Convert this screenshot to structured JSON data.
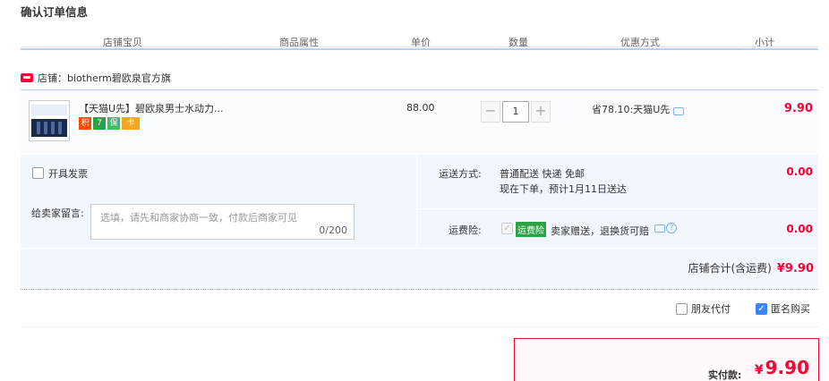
{
  "section_title": "确认订单信息",
  "columns": [
    "店铺宝贝",
    "商品属性",
    "单价",
    "数量",
    "优惠方式",
    "小计"
  ],
  "shop": {
    "label": "店铺：biotherm碧欧泉官方旗"
  },
  "item": {
    "title": "【天猫U先】碧欧泉男士水动力...",
    "badges": [
      "积",
      "7",
      "保",
      "卡"
    ],
    "unit_price": "88.00",
    "quantity": "1",
    "decrement": "−",
    "increment": "+",
    "discount": "省78.10:天猫U先",
    "subtotal": "9.90"
  },
  "invoice": {
    "label": "开具发票"
  },
  "message": {
    "label": "给卖家留言:",
    "placeholder": "选填，请先和商家协商一致，付款后商家可见",
    "count": "0/200"
  },
  "shipping": {
    "label": "运送方式:",
    "line1": "普通配送 快递 免邮",
    "line2": "现在下单，预计1月11日送达",
    "price": "0.00"
  },
  "insurance": {
    "label": "运费险:",
    "check": "✓",
    "badge": "运费险",
    "text": "卖家赠送，退换货可赔",
    "question": "?",
    "price": "0.00"
  },
  "shop_total": {
    "label": "店铺合计(含运费)",
    "amount": "¥9.90"
  },
  "options": {
    "friend_pay": "朋友代付",
    "anonymous": "匿名购买",
    "anonymous_check": "✓"
  },
  "payment": {
    "label": "实付款:",
    "currency": "¥",
    "amount": "9.90"
  },
  "colors": {
    "accent_red": "#ff0036",
    "border_blue": "#b2d1ff",
    "bg_blue": "#f2f7ff"
  }
}
